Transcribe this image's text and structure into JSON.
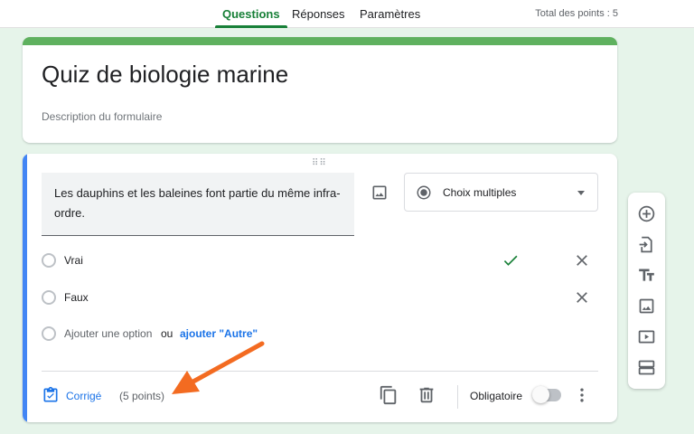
{
  "nav": {
    "tabs": [
      {
        "label": "Questions",
        "active": true
      },
      {
        "label": "Réponses",
        "active": false
      },
      {
        "label": "Paramètres",
        "active": false
      }
    ],
    "total_points": "Total des points : 5"
  },
  "form": {
    "title": "Quiz de biologie marine",
    "description": "Description du formulaire"
  },
  "question": {
    "text": "Les dauphins et les baleines font partie du même infra-ordre.",
    "type_label": "Choix multiples",
    "options": [
      {
        "label": "Vrai",
        "correct": true
      },
      {
        "label": "Faux",
        "correct": false
      }
    ],
    "add_option_label": "Ajouter une option",
    "or_label": "ou",
    "add_other_label": "ajouter \"Autre\"",
    "footer": {
      "answer_key_label": "Corrigé",
      "points_label": "(5 points)",
      "required_label": "Obligatoire",
      "required_on": false
    }
  },
  "colors": {
    "accent_green": "#188038",
    "header_strip": "#5fb15f",
    "active_question": "#4285f4",
    "link_blue": "#1a73e8",
    "background": "#e6f4ea",
    "annotation_arrow": "#f36b21"
  },
  "icons": {
    "question_image": "image-icon",
    "type_radio": "radio-checked-icon",
    "correct": "check-icon",
    "remove": "close-icon",
    "answer_key": "assignment-check-icon",
    "duplicate": "copy-icon",
    "delete": "trash-icon",
    "more": "more-vert-icon",
    "toolbar": [
      "add-circle-icon",
      "import-icon",
      "title-icon",
      "image-icon",
      "video-icon",
      "section-icon"
    ]
  }
}
